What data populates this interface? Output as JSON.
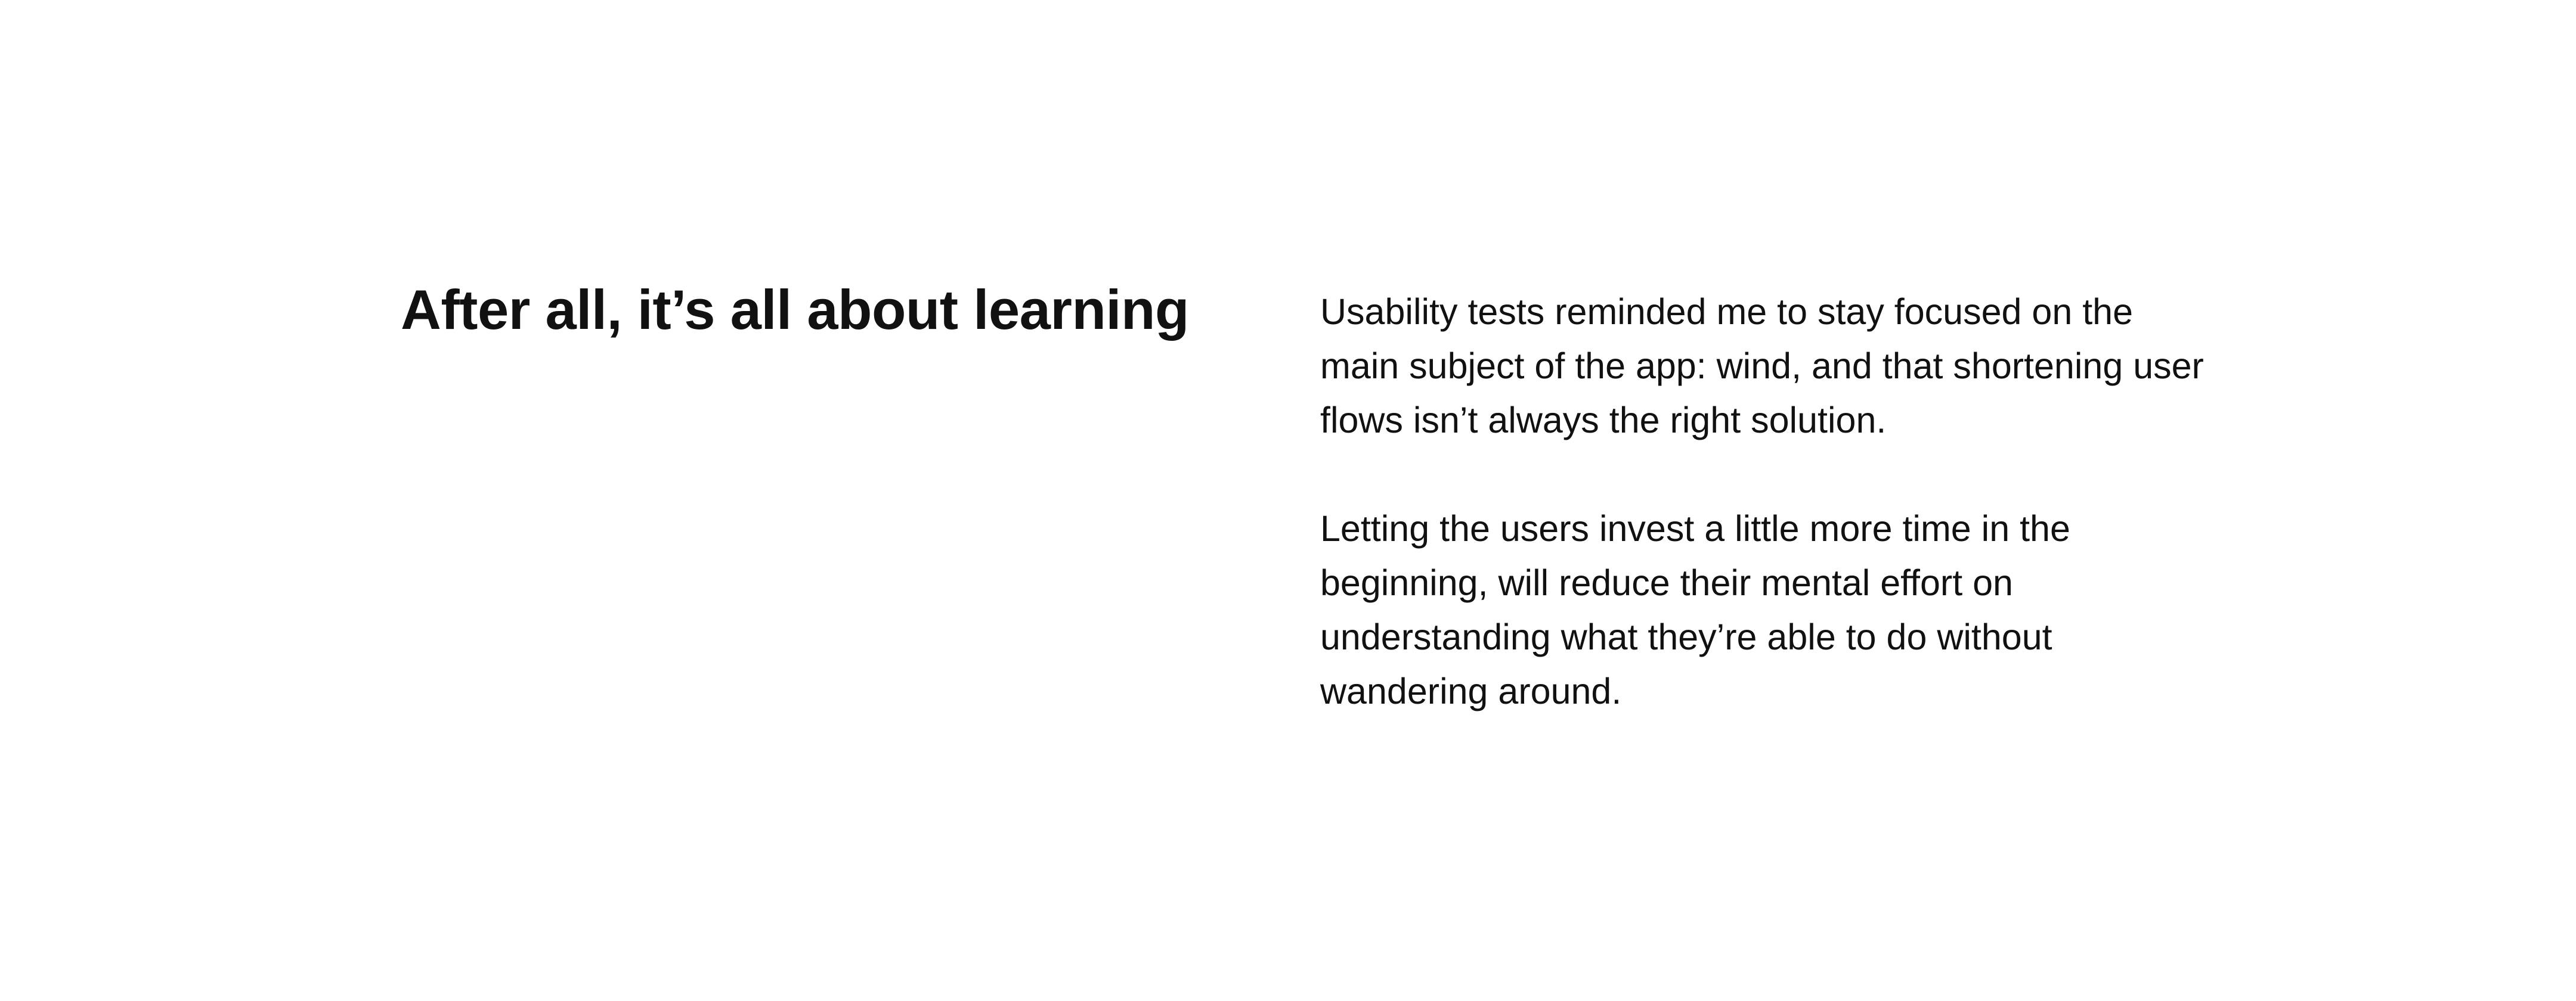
{
  "section": {
    "heading": "After all, it’s all about learning",
    "paragraphs": [
      "Usability tests reminded me to stay focused on the main subject of the app: wind, and that shortening user flows isn’t always the right solution.",
      "Letting the users invest a little more time in the beginning, will reduce their mental effort on understanding what they’re able to do without wandering around."
    ]
  },
  "colors": {
    "background": "#ffffff",
    "text": "#111111"
  }
}
